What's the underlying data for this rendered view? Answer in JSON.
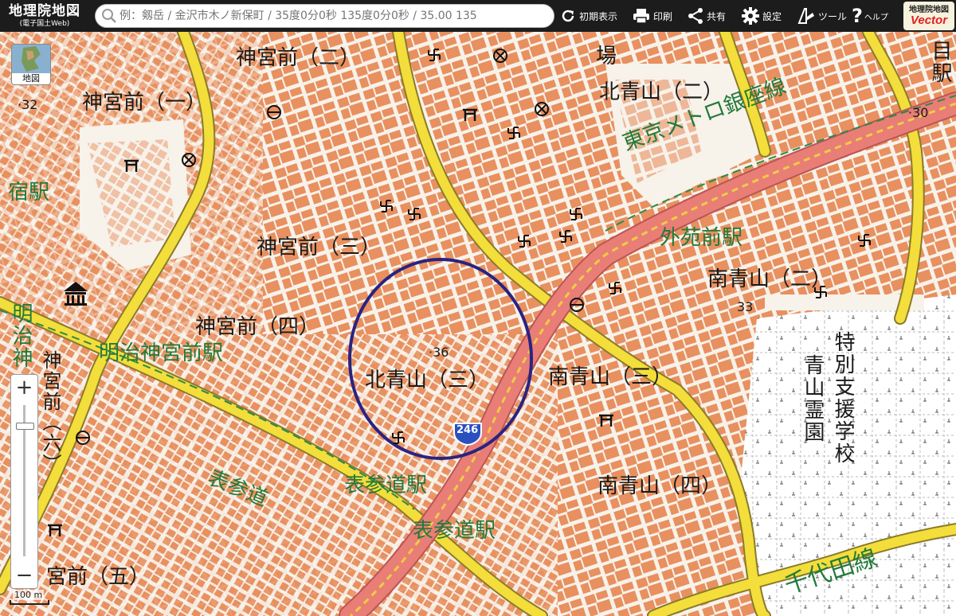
{
  "app": {
    "title": "地理院地図",
    "subtitle": "(電子国土Web)"
  },
  "search": {
    "placeholder": "例：剱岳 / 金沢市木ノ新保町 / 35度0分0秒 135度0分0秒 / 35.00 135"
  },
  "toolbar": {
    "reset_label": "初期表示",
    "print_label": "印刷",
    "share_label": "共有",
    "settings_label": "設定",
    "tools_label": "ツール",
    "help_label": "ヘルプ"
  },
  "vector_badge": {
    "line1": "地理院地図",
    "line2": "Vector"
  },
  "map_type": {
    "label": "地図"
  },
  "scale": {
    "label": "100 m"
  },
  "zoom": {
    "plus": "+",
    "minus": "−"
  },
  "colors": {
    "toolbar_bg": "#1c1c1c",
    "building": "#e8905f",
    "major_road": "#f3de3b",
    "expressway": "#e87e76",
    "subway_label": "#227a3a",
    "highlight_circle": "#2a2380"
  },
  "labels": {
    "jingumae2": "神宮前（二）",
    "jingumae1": "神宮前（一）",
    "jingumae3": "神宮前（三）",
    "jingumae4": "神宮前（四）",
    "jingumae5": "宮前（五）",
    "jingumae6_vert": "神宮前（六）",
    "kitaaoyama2": "北青山（二）",
    "kitaaoyama3": "北青山（三）",
    "minamiaoyama2": "南青山（二）",
    "minamiaoyama3": "南青山（三）",
    "minamiaoyama4": "南青山（四）",
    "tokubetsu": "特別支援学校",
    "reien": "青山霊園",
    "jo": "場",
    "meji_vert": "明治神",
    "mokuji_vert": "目駅",
    "elev_32": "·32",
    "elev_30": "·30",
    "elev_33": "33",
    "elev_36": "·36",
    "route_no": "246"
  },
  "green_labels": {
    "ginza_line": "東京メトロ銀座線",
    "gaienmae": "外苑前駅",
    "meiji_jingumae": "明治神宮前駅",
    "omotesando_st1": "表参道駅",
    "omotesando_st2": "表参道駅",
    "omotesando": "表参道",
    "chiyoda_line": "千代田線",
    "juku": "宿駅",
    "mei_vert": "明治神"
  }
}
